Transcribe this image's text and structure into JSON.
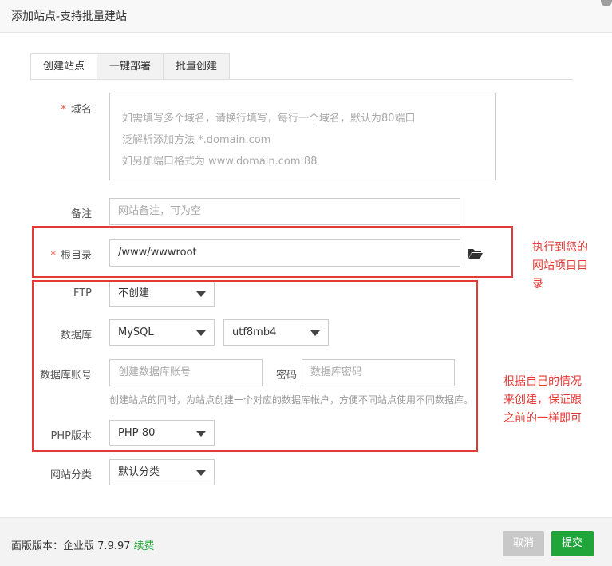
{
  "window": {
    "title": "添加站点-支持批量建站"
  },
  "tabs": [
    {
      "label": "创建站点",
      "active": true
    },
    {
      "label": "一键部署",
      "active": false
    },
    {
      "label": "批量创建",
      "active": false
    }
  ],
  "form": {
    "required_mark": "*",
    "domain": {
      "label": "域名",
      "placeholder_lines": [
        "如需填写多个域名，请换行填写，每行一个域名，默认为80端口",
        "泛解析添加方法 *.domain.com",
        "如另加端口格式为 www.domain.com:88"
      ]
    },
    "remark": {
      "label": "备注",
      "placeholder": "网站备注，可为空"
    },
    "root": {
      "label": "根目录",
      "value": "/www/wwwroot"
    },
    "ftp": {
      "label": "FTP",
      "selected": "不创建"
    },
    "database": {
      "label": "数据库",
      "type": "MySQL",
      "charset": "utf8mb4"
    },
    "db_account": {
      "label": "数据库账号",
      "placeholder": "创建数据库账号"
    },
    "db_password": {
      "label": "密码",
      "placeholder": "数据库密码"
    },
    "db_help": "创建站点的同时，为站点创建一个对应的数据库帐户，方便不同站点使用不同数据库。",
    "php": {
      "label": "PHP版本",
      "selected": "PHP-80"
    },
    "category": {
      "label": "网站分类",
      "selected": "默认分类"
    }
  },
  "annotations": {
    "root_note": [
      "执行到您的",
      "网站项目目",
      "录"
    ],
    "db_note": [
      "根据自己的情况",
      "来创建，保证跟",
      "之前的一样即可"
    ]
  },
  "footer": {
    "version_label": "面版版本：企业版 7.9.97",
    "renew_link": "续费",
    "cancel_label": "取消",
    "submit_label": "提交"
  },
  "colors": {
    "accent": "#20a53a",
    "annotation_red": "#e53935",
    "required_red": "#e74c3c"
  },
  "icons": {
    "browse": "folder-open-icon"
  }
}
